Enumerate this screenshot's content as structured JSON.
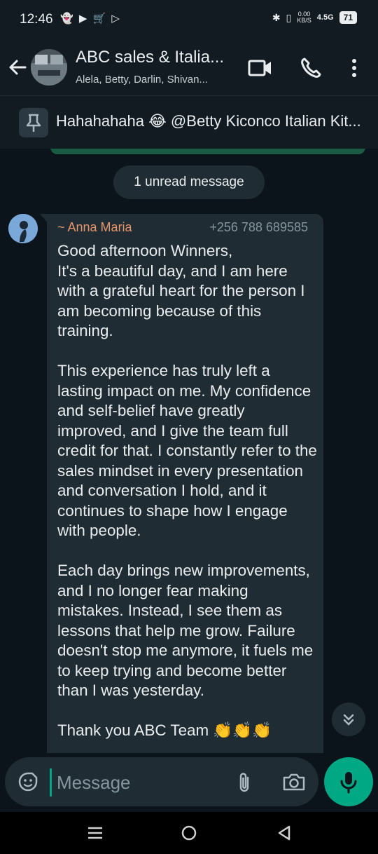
{
  "status_bar": {
    "time": "12:46",
    "app_icons": "👻 ▶ 🛒 ▷",
    "net_speed_value": "0.00",
    "net_speed_unit": "KB/S",
    "network": "4.5G",
    "battery": "71"
  },
  "header": {
    "title": "ABC sales & Italia...",
    "members": "Alela, Betty, Darlin, Shivan..."
  },
  "pinned": {
    "text": "Hahahahaha 😂 @Betty Kiconco Italian Kit..."
  },
  "chat": {
    "unread_label": "1 unread message",
    "message": {
      "sender_name": "~ Anna Maria",
      "sender_phone": "+256 788 689585",
      "body": "Good afternoon Winners,\nIt's a beautiful day, and I am here with a grateful heart for the person I am becoming because of this training.\n\nThis experience has truly left a lasting impact on me. My confidence and self-belief have greatly improved, and I give the team full credit for that. I constantly refer to the sales mindset in every presentation and conversation I hold, and it continues to shape how I engage with people.\n\nEach day brings new improvements, and I no longer fear making mistakes. Instead, I see them as lessons that help me grow. Failure doesn't stop me anymore, it fuels me to keep trying and become better than I was yesterday.\n\nThank you ABC Team 👏👏👏"
    }
  },
  "composer": {
    "placeholder": "Message"
  },
  "colors": {
    "background": "#0b141a",
    "bar": "#121b22",
    "bubble": "#1f2c33",
    "accent_green": "#00a884",
    "sender_name": "#e8956b"
  }
}
